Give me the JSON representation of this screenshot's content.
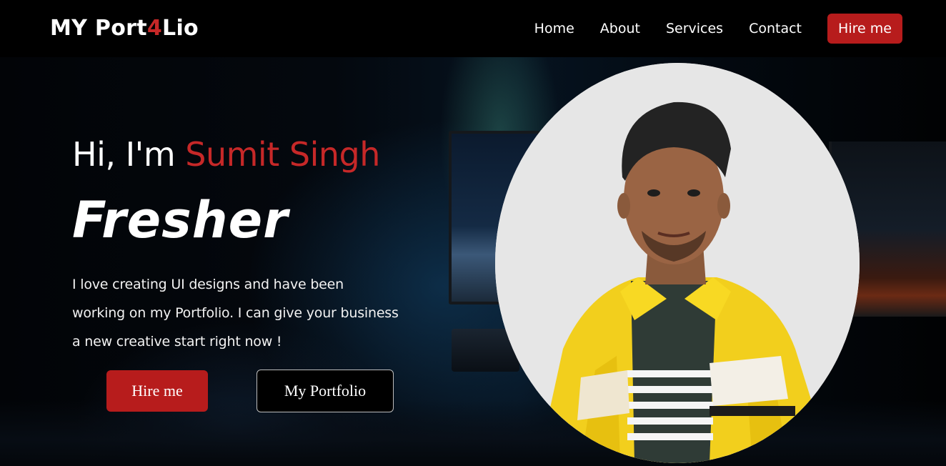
{
  "header": {
    "logo_prefix": "MY Port",
    "logo_accent": "4",
    "logo_suffix": "Lio",
    "nav": [
      "Home",
      "About",
      "Services",
      "Contact"
    ],
    "cta_label": "Hire me"
  },
  "hero": {
    "greeting_prefix": "Hi, I'm ",
    "name": "Sumit Singh",
    "role": "Fresher",
    "bio_lines": [
      "I love creating UI designs and have been",
      "working on my Portfolio. I can give your business",
      "a new creative start right now !"
    ],
    "hire_button": "Hire me",
    "portfolio_button": "My Portfolio"
  },
  "colors": {
    "accent": "#c62828",
    "button_red": "#b71c1c",
    "background": "#000000"
  }
}
